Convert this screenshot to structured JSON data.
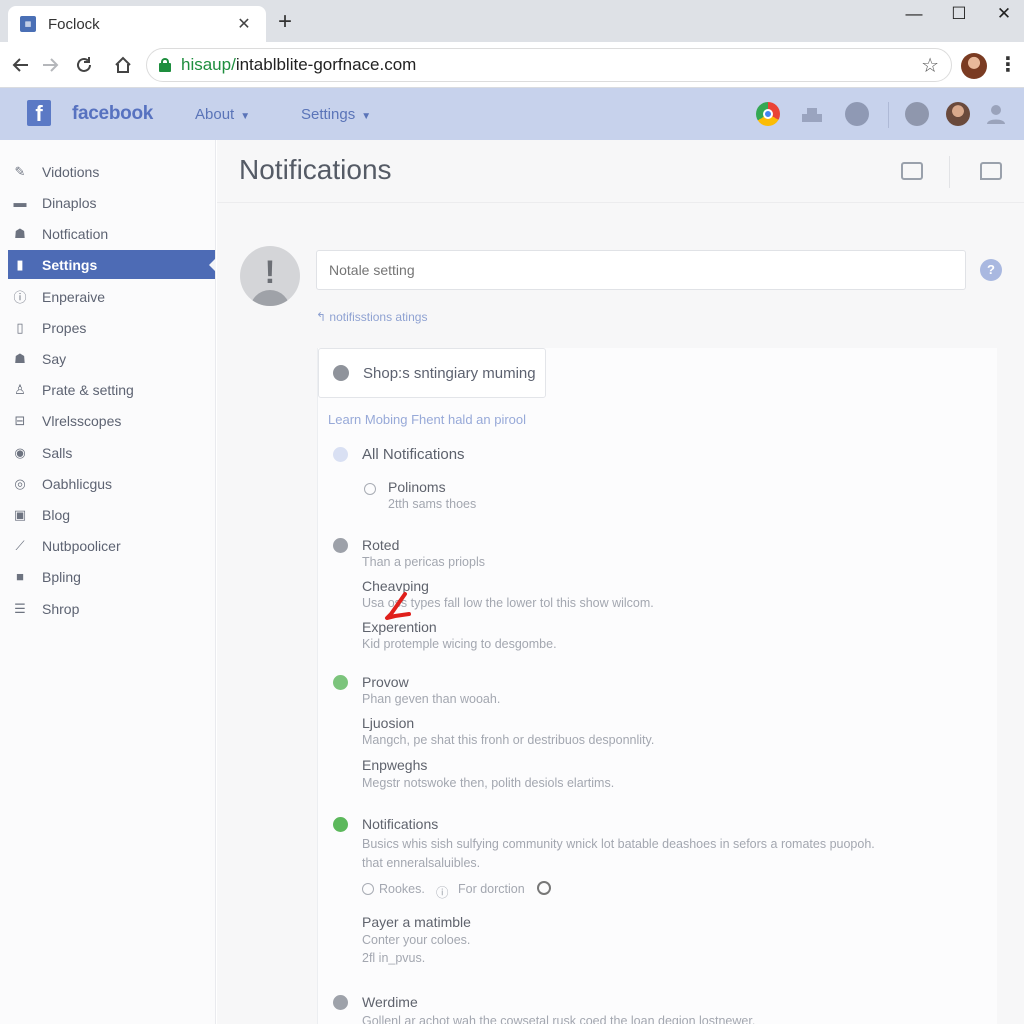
{
  "browser": {
    "tab_title": "Foclock",
    "url_scheme": "hisaup/",
    "url_rest": "intablblite-gorfnace.com",
    "back_icon": "arrow-left-icon",
    "forward_icon": "arrow-right-icon",
    "reload_icon": "reload-icon",
    "home_icon": "home-icon",
    "bookmark_icon": "star-icon"
  },
  "header": {
    "logo_letter": "f",
    "brand": "facebook",
    "menu": [
      "About",
      "Settings"
    ]
  },
  "sidebar": {
    "items": [
      {
        "label": "Vidotions",
        "icon": "pen-icon"
      },
      {
        "label": "Dinaplos",
        "icon": "card-icon"
      },
      {
        "label": "Notfication",
        "icon": "person-icon"
      },
      {
        "label": "Settings",
        "icon": "bars-icon",
        "active": true
      },
      {
        "label": "Enperaive",
        "icon": "info-circle-icon"
      },
      {
        "label": "Propes",
        "icon": "document-icon"
      },
      {
        "label": "Say",
        "icon": "people-icon"
      },
      {
        "label": "Prate & setting",
        "icon": "user-outline-icon"
      },
      {
        "label": "Vlrelsscopes",
        "icon": "window-icon"
      },
      {
        "label": "Salls",
        "icon": "globe-icon"
      },
      {
        "label": "Oabhlicgus",
        "icon": "target-icon"
      },
      {
        "label": "Blog",
        "icon": "lock-icon"
      },
      {
        "label": "Nutbpoolicer",
        "icon": "link-icon"
      },
      {
        "label": "Bpling",
        "icon": "box-icon"
      },
      {
        "label": "Shrop",
        "icon": "list-icon"
      }
    ]
  },
  "main": {
    "title": "Notifications",
    "input_placeholder": "Notale setting",
    "help_glyph": "?",
    "warning_glyph": "!",
    "back_link": "notifisstions atings",
    "card_header": "Shop:s sntingiary muming",
    "learn_link": "Learn Mobing Fhent hald an pirool",
    "all_notifications": "All Notifications",
    "sections": [
      {
        "title": "Polinoms",
        "desc": "2tth sams thoes"
      },
      {
        "title": "Roted",
        "desc": "Than a pericas priopls"
      },
      {
        "title": "Cheavping",
        "desc": "Usa    oss types fall low the lower tol this show wilcom."
      },
      {
        "title": "Experention",
        "desc": "Kid protemple wicing to desgombe."
      },
      {
        "title": "Provow",
        "desc": "Phan geven than wooah."
      },
      {
        "title": "Ljuosion",
        "desc": "Mangch, pe shat this fronh or destribuos desponnlity."
      },
      {
        "title": "Enpweghs",
        "desc": "Megstr notswoke then, polith desiols elartims."
      },
      {
        "title": "Notifications",
        "desc": "Busics whis sish sulfying community wnick lot batable deashoes in sefors a romates puopoh.",
        "desc2": "that enneralsaluibles."
      },
      {
        "title": "Payer a matimble",
        "desc": "Conter your coloes.",
        "desc2": "2fl in_pvus."
      },
      {
        "title": "Werdime",
        "desc": "Gollenl ar achot wah the cowsetal rusk coed the loan degion lostnewer."
      }
    ],
    "radio_options": [
      "Rookes.",
      "For dorction"
    ],
    "colors": {
      "accent": "#4d6bb5",
      "header_bg": "#c7d2ec",
      "green": "#5cb85c"
    }
  }
}
